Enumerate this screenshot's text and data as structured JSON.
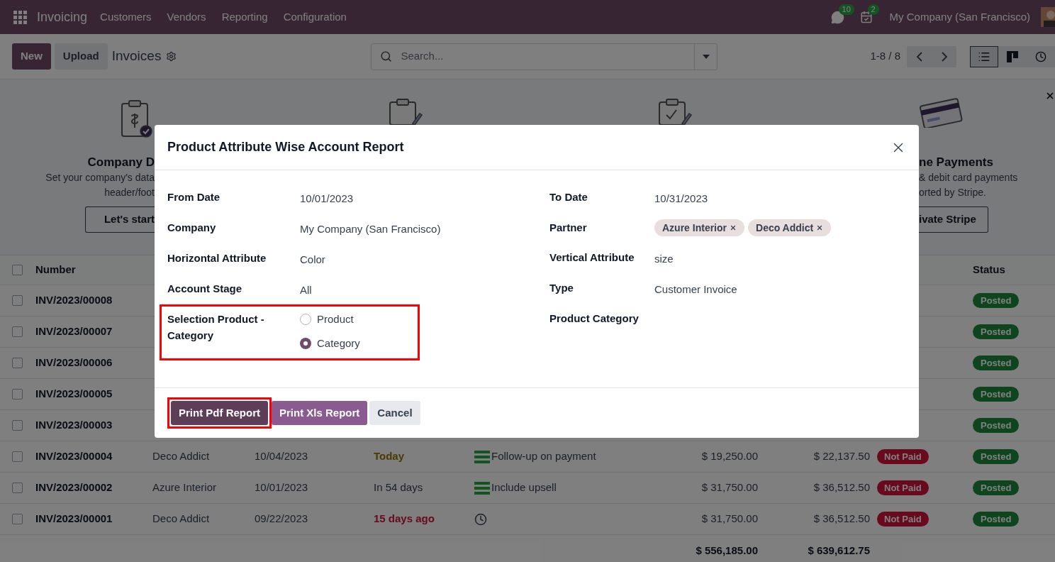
{
  "navbar": {
    "app": "Invoicing",
    "menus": [
      "Customers",
      "Vendors",
      "Reporting",
      "Configuration"
    ],
    "messages_count": "10",
    "activities_count": "2",
    "company": "My Company (San Francisco)"
  },
  "control_panel": {
    "buttons": [
      "New",
      "Upload"
    ],
    "title": "Invoices",
    "search": {
      "placeholder": "Search..."
    },
    "pager": "1-8 / 8",
    "views": [
      {
        "kind": "list",
        "selected": true
      },
      {
        "kind": "kanban",
        "selected": false
      },
      {
        "kind": "activity",
        "selected": false
      }
    ]
  },
  "banner": {
    "cards": [
      {
        "title": "Company D",
        "lines": [
          "Set your company's data",
          "header/foot"
        ],
        "button": "Let's start"
      },
      {
        "title": "ne Payments",
        "lines": [
          "& debit card payments",
          "orted by Stripe."
        ],
        "button": "ivate Stripe"
      }
    ]
  },
  "table": {
    "columns": [
      "Number",
      "Status"
    ],
    "all_selected": false,
    "rows": [
      {
        "selected": false,
        "number": "INV/2023/00008",
        "status": "Posted"
      },
      {
        "selected": false,
        "number": "INV/2023/00007",
        "status": "Posted"
      },
      {
        "selected": false,
        "number": "INV/2023/00006",
        "status": "Posted"
      },
      {
        "selected": false,
        "number": "INV/2023/00005",
        "status": "Posted"
      },
      {
        "selected": false,
        "number": "INV/2023/00003",
        "status": "Posted"
      },
      {
        "selected": false,
        "number": "INV/2023/00004",
        "customer": "Deco Addict",
        "invoice_date": "10/04/2023",
        "due": {
          "kind": "today",
          "text": "Today"
        },
        "activity": {
          "kind": "todo",
          "text": "Follow-up on payment"
        },
        "untaxed": "$ 19,250.00",
        "total": "$ 22,137.50",
        "payment": "Not Paid",
        "status": "Posted"
      },
      {
        "selected": false,
        "number": "INV/2023/00002",
        "customer": "Azure Interior",
        "invoice_date": "10/01/2023",
        "due": {
          "kind": "future",
          "text": "In 54 days"
        },
        "activity": {
          "kind": "todo",
          "text": "Include upsell"
        },
        "untaxed": "$ 31,750.00",
        "total": "$ 36,512.50",
        "payment": "Not Paid",
        "status": "Posted"
      },
      {
        "selected": false,
        "number": "INV/2023/00001",
        "customer": "Deco Addict",
        "invoice_date": "09/22/2023",
        "due": {
          "kind": "overdue",
          "text": "15 days ago"
        },
        "activity": {
          "kind": "clock"
        },
        "untaxed": "$ 31,750.00",
        "total": "$ 36,512.50",
        "payment": "Not Paid",
        "status": "Posted"
      }
    ],
    "totals": {
      "untaxed": "$ 556,185.00",
      "total": "$ 639,612.75"
    }
  },
  "dialog": {
    "title": "Product Attribute Wise Account Report",
    "left_fields": [
      {
        "kind": "text",
        "label": "From Date",
        "value": "10/01/2023",
        "highlighted": false
      },
      {
        "kind": "text",
        "label": "Company",
        "value": "My Company (San Francisco)",
        "highlighted": false
      },
      {
        "kind": "text",
        "label": "Horizontal Attribute",
        "value": "Color",
        "highlighted": false
      },
      {
        "kind": "text",
        "label": "Account Stage",
        "value": "All",
        "highlighted": false
      },
      {
        "kind": "radio",
        "label": "Selection Product - Category",
        "highlighted": true,
        "options": [
          {
            "label": "Product",
            "selected": false
          },
          {
            "label": "Category",
            "selected": true
          }
        ]
      }
    ],
    "right_fields": [
      {
        "kind": "text",
        "label": "To Date",
        "value": "10/31/2023",
        "highlighted": false
      },
      {
        "kind": "tags",
        "label": "Partner",
        "tags": [
          "Azure Interior",
          "Deco Addict"
        ],
        "highlighted": false
      },
      {
        "kind": "text",
        "label": "Vertical Attribute",
        "value": "size",
        "highlighted": false
      },
      {
        "kind": "text",
        "label": "Type",
        "value": "Customer Invoice",
        "highlighted": false
      },
      {
        "kind": "empty",
        "label": "Product Category",
        "highlighted": false
      }
    ],
    "buttons": [
      {
        "label": "Print Pdf Report",
        "kind": "primary",
        "highlighted": true
      },
      {
        "label": "Print Xls Report",
        "kind": "secondary",
        "highlighted": false
      },
      {
        "label": "Cancel",
        "kind": "cancel",
        "highlighted": false
      }
    ]
  }
}
